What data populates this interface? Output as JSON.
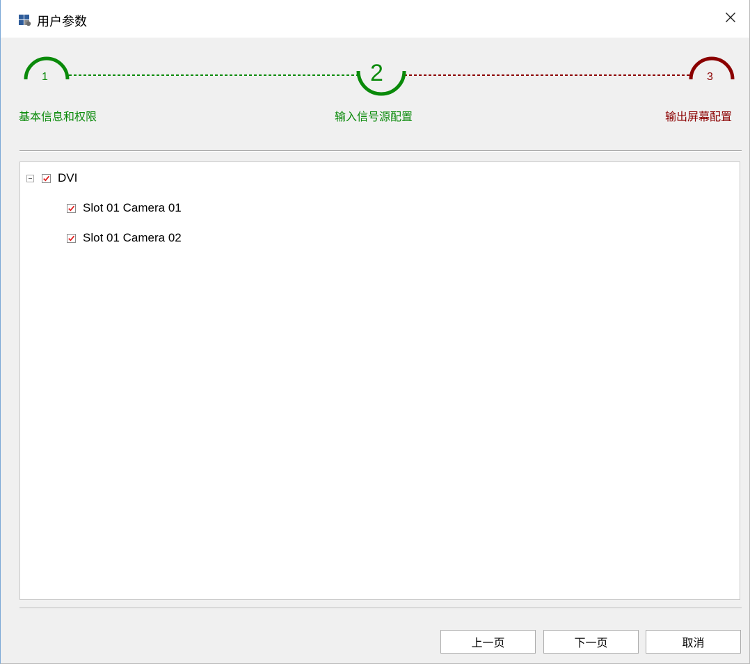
{
  "window": {
    "title": "用户参数",
    "close_symbol": "×",
    "app_icon": "app-grid-icon"
  },
  "wizard": {
    "steps": [
      {
        "number": "1",
        "label": "基本信息和权限",
        "state": "completed",
        "color": "#0a8a0a"
      },
      {
        "number": "2",
        "label": "输入信号源配置",
        "state": "current",
        "color": "#0a8a0a"
      },
      {
        "number": "3",
        "label": "输出屏幕配置",
        "state": "pending",
        "color": "#8b0000"
      }
    ]
  },
  "tree": {
    "items": [
      {
        "label": "DVI",
        "checked": true,
        "expanded": true,
        "level": 0
      },
      {
        "label": "Slot 01 Camera 01",
        "checked": true,
        "level": 1
      },
      {
        "label": "Slot 01 Camera 02",
        "checked": true,
        "level": 1
      }
    ]
  },
  "buttons": {
    "prev": "上一页",
    "next": "下一页",
    "cancel": "取消"
  },
  "colors": {
    "done": "#0a8a0a",
    "pending": "#8b0000",
    "check": "#e02020"
  }
}
